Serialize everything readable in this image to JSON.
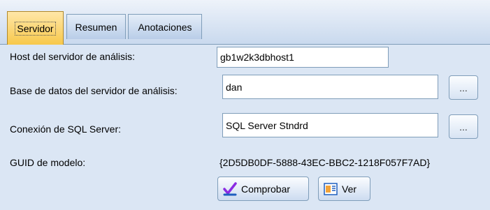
{
  "tabs": [
    {
      "label": "Servidor",
      "active": true
    },
    {
      "label": "Resumen",
      "active": false
    },
    {
      "label": "Anotaciones",
      "active": false
    }
  ],
  "form": {
    "host_label": "Host del servidor de análisis:",
    "host_value": "gb1w2k3dbhost1",
    "db_label": "Base de datos del servidor de análisis:",
    "db_value": "dan",
    "db_browse": "...",
    "sql_label": "Conexión de SQL Server:",
    "sql_value": "SQL Server Stndrd",
    "sql_browse": "...",
    "guid_label": "GUID de modelo:",
    "guid_value": "{2D5DB0DF-5888-43EC-BBC2-1218F057F7AD}"
  },
  "buttons": {
    "check_label": "Comprobar",
    "check_icon": "check-icon",
    "view_label": "Ver",
    "view_icon": "view-icon"
  },
  "colors": {
    "active_tab": "#f7c84b",
    "panel_background": "#dbe6f4"
  }
}
